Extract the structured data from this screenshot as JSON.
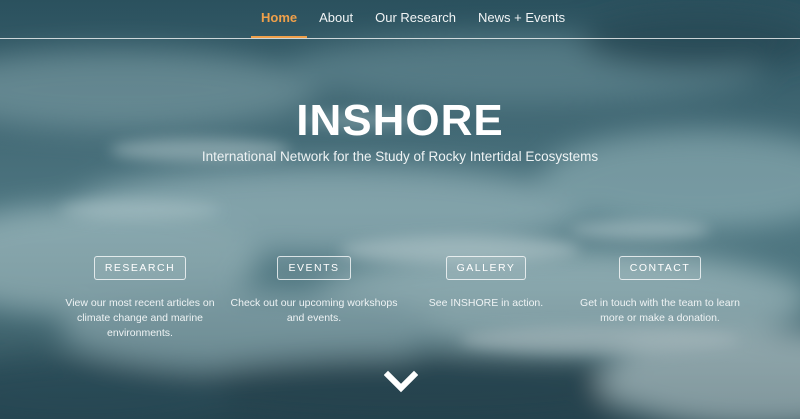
{
  "nav": {
    "items": [
      {
        "label": "Home"
      },
      {
        "label": "About"
      },
      {
        "label": "Our Research"
      },
      {
        "label": "News + Events"
      }
    ],
    "active_color": "#f0a04a"
  },
  "hero": {
    "title": "INSHORE",
    "subtitle": "International Network for the Study of Rocky Intertidal Ecosystems"
  },
  "features": [
    {
      "button": "RESEARCH",
      "text": "View our most recent articles on climate change and marine environments."
    },
    {
      "button": "EVENTS",
      "text": "Check out our upcoming workshops and events."
    },
    {
      "button": "GALLERY",
      "text": "See INSHORE in action."
    },
    {
      "button": "CONTACT",
      "text": "Get in touch with the team to learn more or make a donation."
    }
  ],
  "scroll": {
    "icon": "chevron-down-icon"
  }
}
